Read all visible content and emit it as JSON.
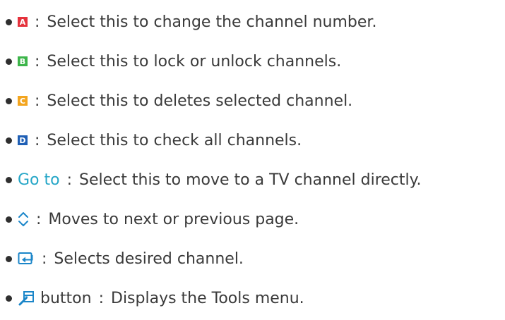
{
  "items": [
    {
      "key_icon": "red-a-button-icon",
      "key_letter": "A",
      "key_color": "#e5323c",
      "text": "Select this to change the channel number."
    },
    {
      "key_icon": "green-b-button-icon",
      "key_letter": "B",
      "key_color": "#3db54a",
      "text": "Select this to lock or unlock channels."
    },
    {
      "key_icon": "yellow-c-button-icon",
      "key_letter": "C",
      "key_color": "#f3a51f",
      "text": "Select this to deletes selected channel."
    },
    {
      "key_icon": "blue-d-button-icon",
      "key_letter": "D",
      "key_color": "#1f5fb5",
      "text": "Select this to check all channels."
    },
    {
      "key_label": "Go to",
      "key_color": "#25a6c7",
      "text": "Select this to move to a TV channel directly."
    },
    {
      "key_icon": "up-down-arrows-icon",
      "text": "Moves to next or previous page."
    },
    {
      "key_icon": "enter-icon",
      "text": "Selects desired channel."
    },
    {
      "key_icon": "tools-icon",
      "key_label": "button",
      "text": "Displays the Tools menu."
    }
  ],
  "separator": ":",
  "colors": {
    "icon_blue": "#1b86c9",
    "text": "#3a3a3a"
  }
}
